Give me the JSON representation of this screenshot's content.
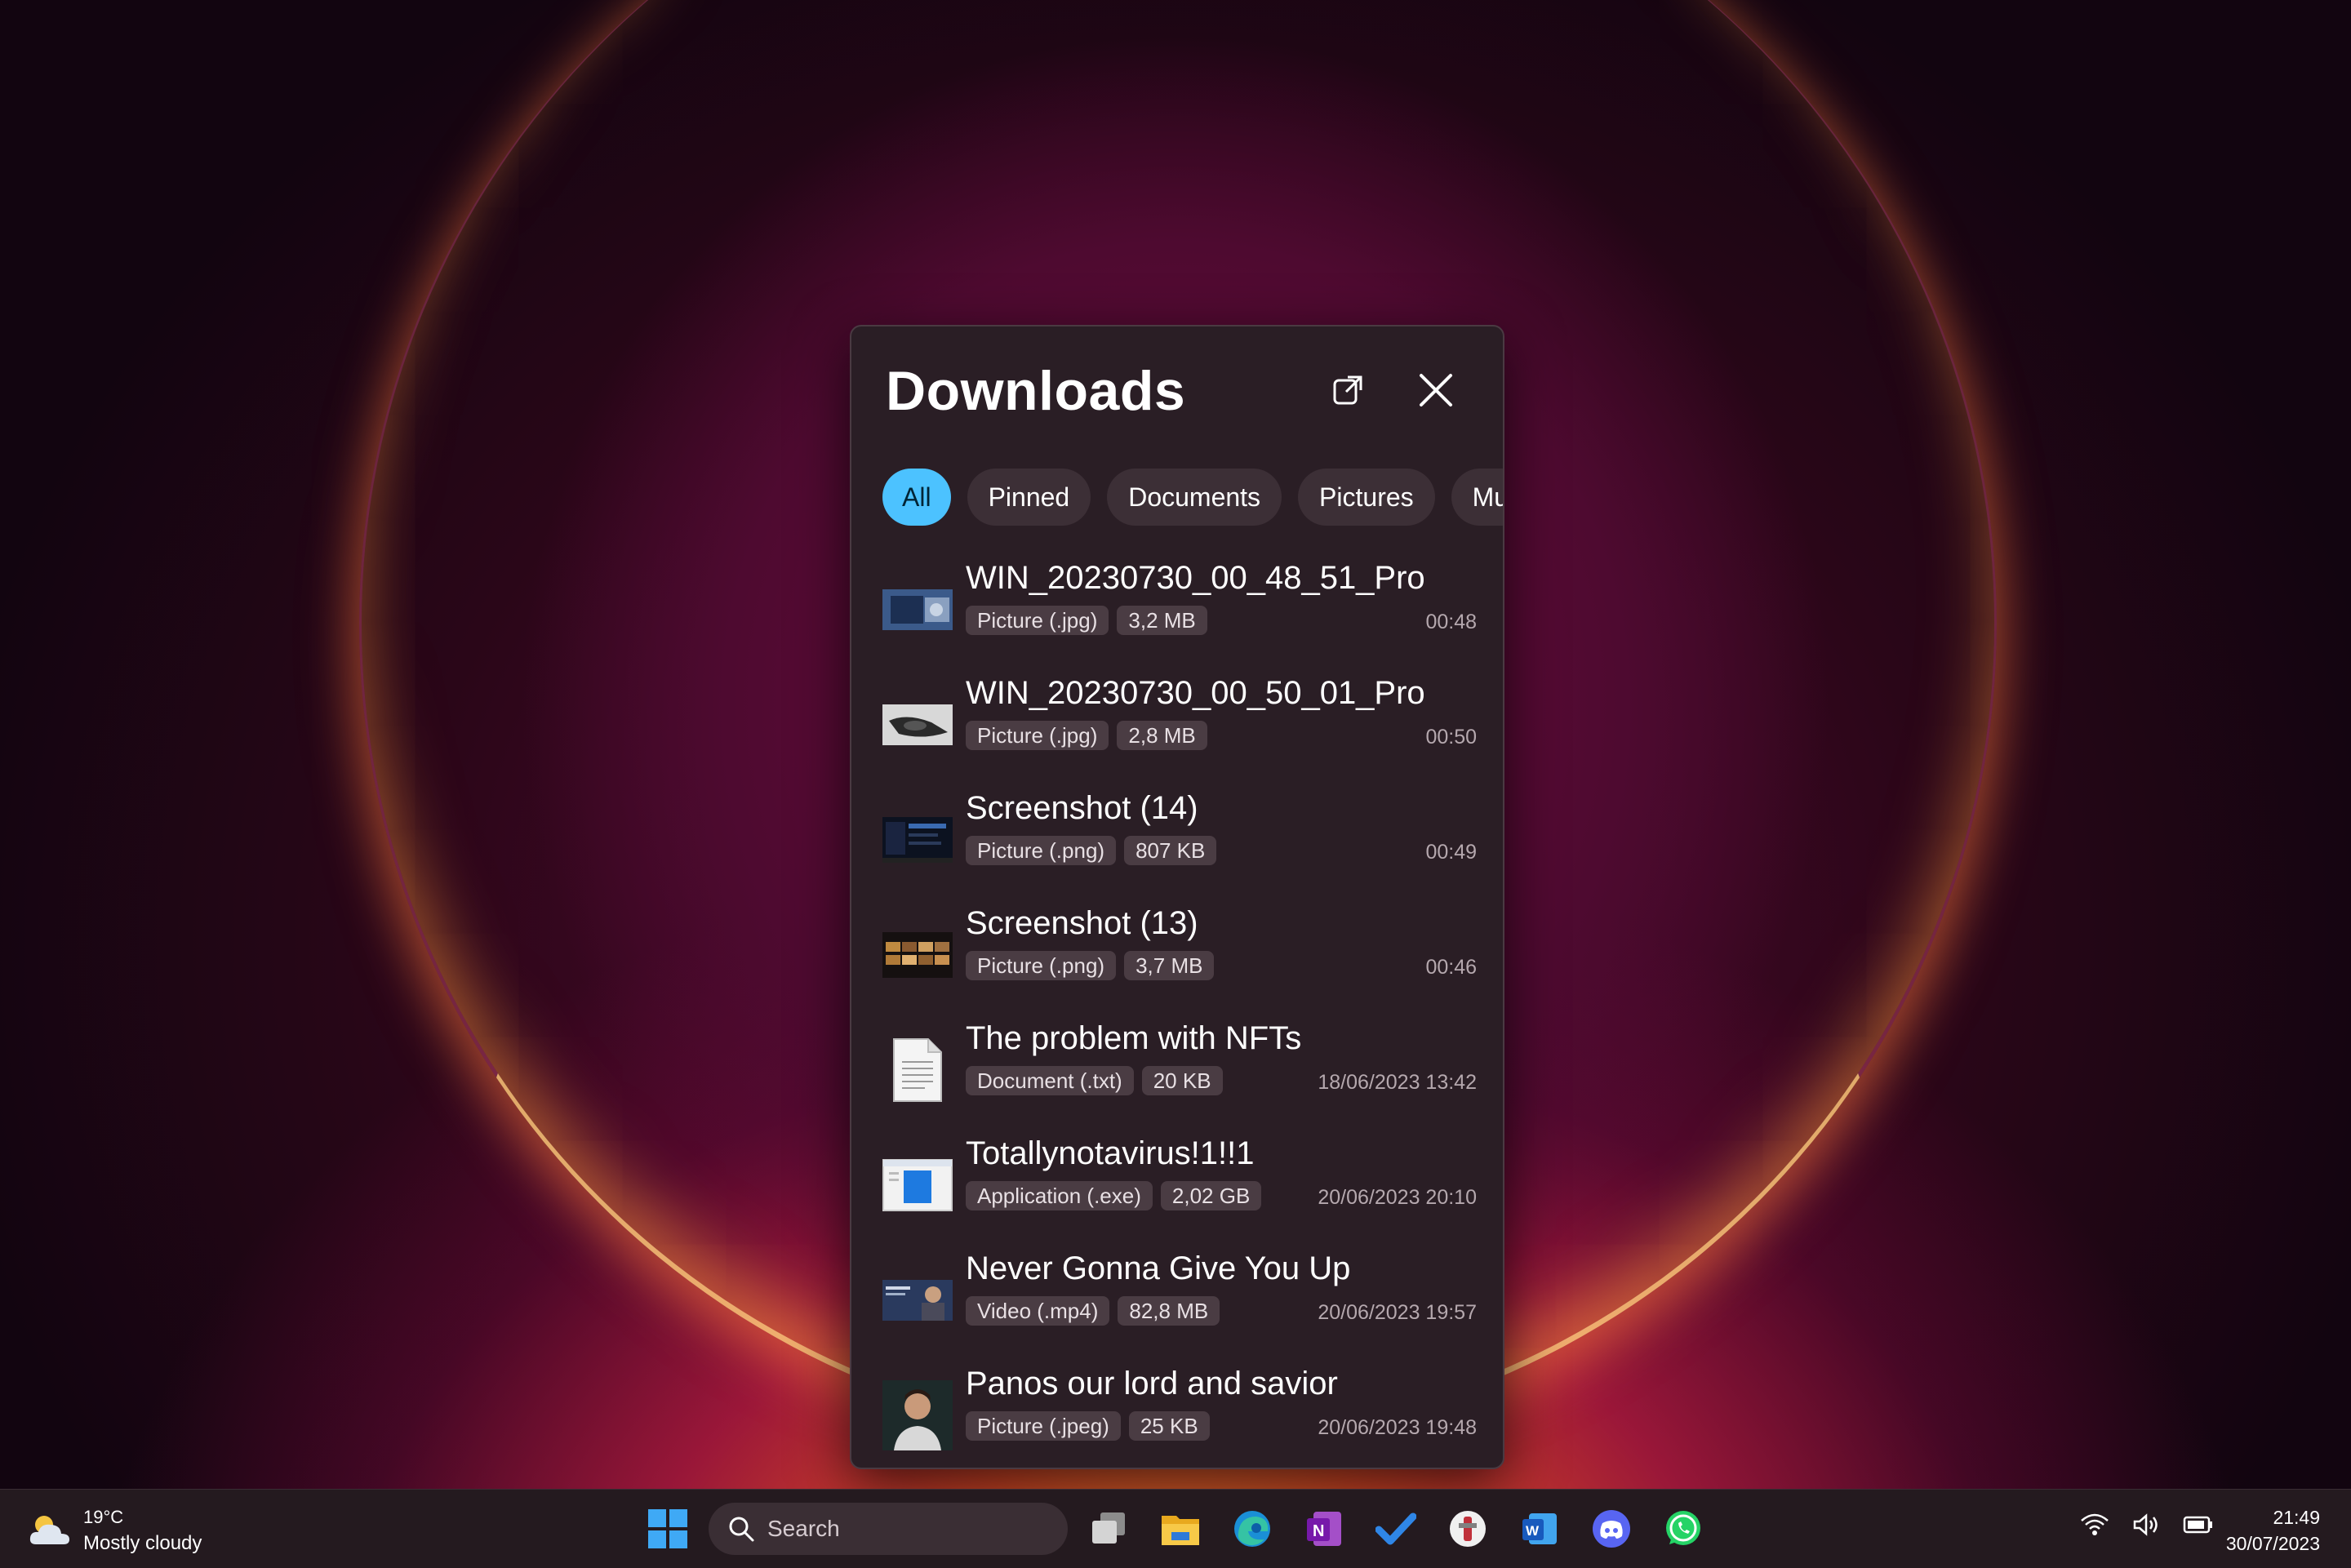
{
  "panel": {
    "title": "Downloads",
    "filters": [
      {
        "label": "All",
        "active": true
      },
      {
        "label": "Pinned",
        "active": false
      },
      {
        "label": "Documents",
        "active": false
      },
      {
        "label": "Pictures",
        "active": false
      },
      {
        "label": "Music",
        "active": false
      }
    ],
    "items": [
      {
        "name": "WIN_20230730_00_48_51_Pro",
        "type": "Picture (.jpg)",
        "size": "3,2 MB",
        "time": "00:48",
        "thumb": "photo-desk-icon"
      },
      {
        "name": "WIN_20230730_00_50_01_Pro",
        "type": "Picture (.jpg)",
        "size": "2,8 MB",
        "time": "00:50",
        "thumb": "photo-object-icon"
      },
      {
        "name": "Screenshot (14)",
        "type": "Picture (.png)",
        "size": "807 KB",
        "time": "00:49",
        "thumb": "screenshot-dark-icon"
      },
      {
        "name": "Screenshot (13)",
        "type": "Picture (.png)",
        "size": "3,7 MB",
        "time": "00:46",
        "thumb": "screenshot-grid-icon"
      },
      {
        "name": "The problem with NFTs",
        "type": "Document (.txt)",
        "size": "20 KB",
        "time": "18/06/2023 13:42",
        "thumb": "text-document-icon"
      },
      {
        "name": "Totallynotavirus!1!!1",
        "type": "Application (.exe)",
        "size": "2,02 GB",
        "time": "20/06/2023 20:10",
        "thumb": "application-icon"
      },
      {
        "name": "Never Gonna Give You Up",
        "type": "Video (.mp4)",
        "size": "82,8 MB",
        "time": "20/06/2023 19:57",
        "thumb": "video-thumbnail-icon"
      },
      {
        "name": "Panos our lord and savior",
        "type": "Picture (.jpeg)",
        "size": "25 KB",
        "time": "20/06/2023 19:48",
        "thumb": "portrait-photo-icon"
      }
    ]
  },
  "taskbar": {
    "weather": {
      "temp": "19°C",
      "desc": "Mostly cloudy",
      "icon": "cloud-sun-icon"
    },
    "search_label": "Search",
    "apps": [
      "task-view-icon",
      "file-explorer-icon",
      "edge-icon",
      "onenote-icon",
      "todo-icon",
      "app-icon",
      "word-icon",
      "discord-icon",
      "whatsapp-icon"
    ],
    "tray": [
      "wifi-icon",
      "volume-icon",
      "battery-icon"
    ],
    "time": "21:49",
    "date": "30/07/2023"
  },
  "colors": {
    "accent": "#4cc2ff",
    "panel_bg": "#2a1e25",
    "chip_bg": "#3c2f36"
  }
}
